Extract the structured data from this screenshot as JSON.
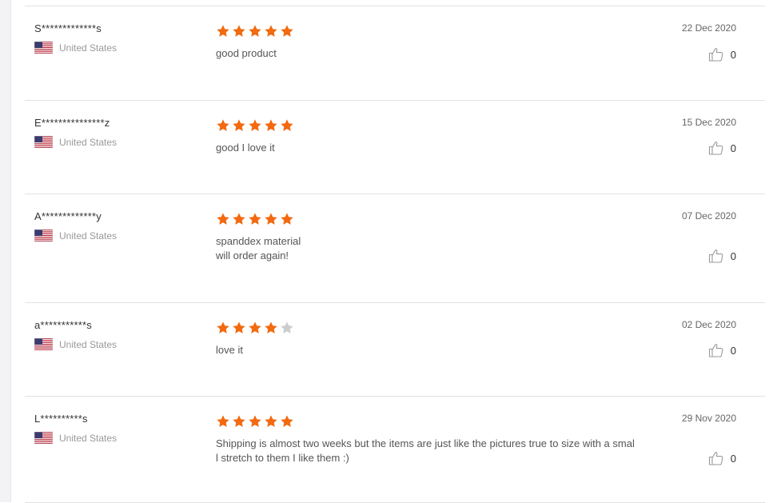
{
  "colors": {
    "star_filled": "#f26a10",
    "star_empty": "#cccccc",
    "divider": "#e2e2e2"
  },
  "icons": {
    "flag": "us-flag-icon",
    "like": "thumbs-up-icon",
    "star": "star-icon"
  },
  "reviews": [
    {
      "username": "S*************s",
      "country": "United States",
      "rating": 5,
      "text": "good product",
      "date": "22 Dec 2020",
      "likes": "0"
    },
    {
      "username": "E***************z",
      "country": "United States",
      "rating": 5,
      "text": "good I love it",
      "date": "15 Dec 2020",
      "likes": "0"
    },
    {
      "username": "A*************y",
      "country": "United States",
      "rating": 5,
      "text": "spanddex material\nwill order again!",
      "date": "07 Dec 2020",
      "likes": "0"
    },
    {
      "username": "a***********s",
      "country": "United States",
      "rating": 4,
      "text": "love it",
      "date": "02 Dec 2020",
      "likes": "0"
    },
    {
      "username": "L**********s",
      "country": "United States",
      "rating": 5,
      "text": "Shipping is almost two weeks but the items are just like the pictures true to size with a smal\nl stretch to them I like them :)",
      "date": "29 Nov 2020",
      "likes": "0"
    }
  ]
}
